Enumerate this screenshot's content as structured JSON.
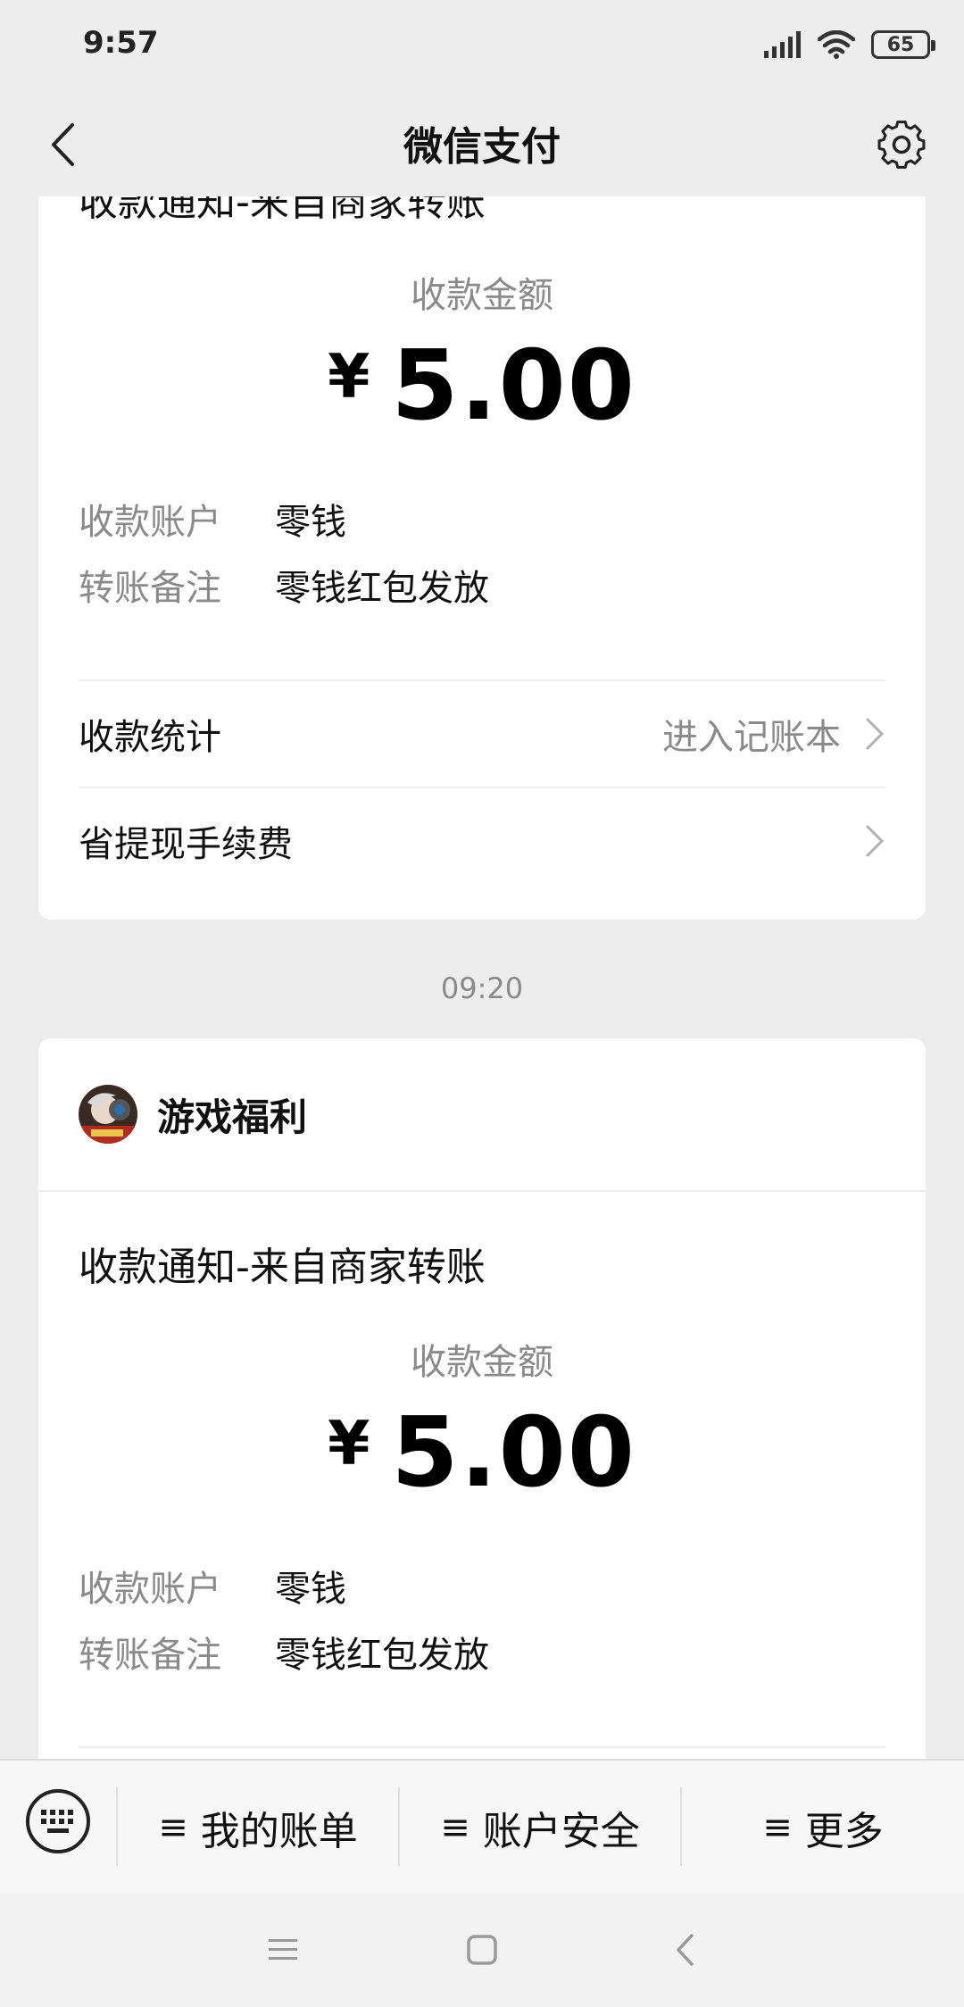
{
  "status_bar": {
    "time": "9:57",
    "battery": "65"
  },
  "nav": {
    "title": "微信支付"
  },
  "card1": {
    "notice_title": "收款通知-来自商家转账",
    "amount_label": "收款金额",
    "currency": "¥",
    "amount": "5.00",
    "details": [
      {
        "key": "收款账户",
        "value": "零钱"
      },
      {
        "key": "转账备注",
        "value": "零钱红包发放"
      }
    ],
    "menu": [
      {
        "label": "收款统计",
        "right": "进入记账本"
      },
      {
        "label": "省提现手续费",
        "right": ""
      }
    ]
  },
  "timestamp": "09:20",
  "card2": {
    "merchant_name": "游戏福利",
    "notice_title": "收款通知-来自商家转账",
    "amount_label": "收款金额",
    "currency": "¥",
    "amount": "5.00",
    "details": [
      {
        "key": "收款账户",
        "value": "零钱"
      },
      {
        "key": "转账备注",
        "value": "零钱红包发放"
      }
    ]
  },
  "bottom_menu": {
    "items": [
      {
        "label": "我的账单"
      },
      {
        "label": "账户安全"
      },
      {
        "label": "更多"
      }
    ],
    "menu_glyph": "≡"
  },
  "colors": {
    "background": "#ededed",
    "card": "#ffffff",
    "secondary_text": "#8a8a8a"
  }
}
